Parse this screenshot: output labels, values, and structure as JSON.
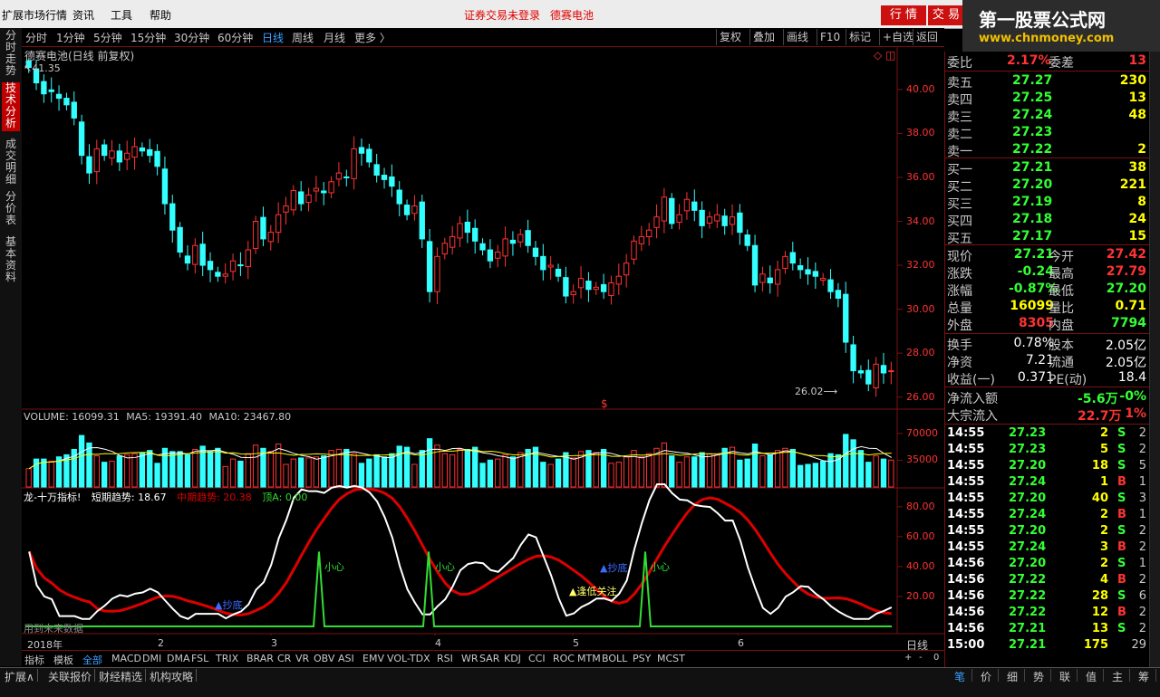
{
  "menu": {
    "items": [
      "扩展市场行情",
      "资讯",
      "工具",
      "帮助"
    ],
    "login_status": "证券交易未登录",
    "stock_name": "德赛电池",
    "btn_quote": "行 情",
    "btn_trade": "交 易"
  },
  "logo": {
    "line1": "第一股票公式网",
    "line2": "www.chnmoney.com"
  },
  "side_tabs": [
    "分时走势",
    "技术分析",
    "成交明细",
    "分价表",
    "基本资料"
  ],
  "periods": [
    "分时",
    "1分钟",
    "5分钟",
    "15分钟",
    "30分钟",
    "60分钟",
    "日线",
    "周线",
    "月线",
    "更多 〉"
  ],
  "active_period": "日线",
  "toolbar": [
    "复权",
    "叠加",
    "画线",
    "F10",
    "标记",
    "+自选",
    "返回"
  ],
  "main_chart": {
    "title": "德赛电池(日线 前复权)",
    "high_label": "41.35",
    "low_label": "26.02",
    "price_ticks": [
      "40.00",
      "38.00",
      "36.00",
      "34.00",
      "32.00",
      "30.00",
      "28.00",
      "26.00"
    ],
    "marker": "$"
  },
  "volume": {
    "legend_volume": "VOLUME: 16099.31",
    "legend_ma5": "MA5: 19391.40",
    "legend_ma10": "MA10: 23467.80",
    "ticks": [
      "70000",
      "35000"
    ]
  },
  "indicator": {
    "name": "龙-十万指标!",
    "short_trend": "短期趋势: 18.67",
    "mid_trend": "中期趋势: 20.38",
    "top_a": "顶A: 0.00",
    "ticks": [
      "80.00",
      "60.00",
      "40.00",
      "20.00"
    ],
    "future_note": "用到未来数据",
    "sig_careful": "小心",
    "sig_bottom": "抄底",
    "sig_watch": "逢低关注"
  },
  "x_axis": {
    "year": "2018年",
    "months": [
      "2",
      "3",
      "4",
      "5",
      "6"
    ],
    "period_label": "日线"
  },
  "indicator_tabs": [
    "指标",
    "模板",
    "全部",
    "MACD",
    "DMI",
    "DMA",
    "FSL",
    "TRIX",
    "BRAR",
    "CR",
    "VR",
    "OBV",
    "ASI",
    "EMV",
    "VOL-TDX",
    "RSI",
    "WR",
    "SAR",
    "KDJ",
    "CCI",
    "ROC",
    "MTM",
    "BOLL",
    "PSY",
    "MCST"
  ],
  "zoom_controls": [
    "+",
    "-",
    "0"
  ],
  "bottom_tabs": [
    "扩展∧",
    "关联报价",
    "财经精选",
    "机构攻略"
  ],
  "quote": {
    "weibi_label": "委比",
    "weibi": "2.17%",
    "weicha_label": "委差",
    "weicha": "13",
    "asks": [
      {
        "label": "卖五",
        "price": "27.27",
        "vol": "230"
      },
      {
        "label": "卖四",
        "price": "27.25",
        "vol": "13"
      },
      {
        "label": "卖三",
        "price": "27.24",
        "vol": "48"
      },
      {
        "label": "卖二",
        "price": "27.23",
        "vol": ""
      },
      {
        "label": "卖一",
        "price": "27.22",
        "vol": "2"
      }
    ],
    "bids": [
      {
        "label": "买一",
        "price": "27.21",
        "vol": "38"
      },
      {
        "label": "买二",
        "price": "27.20",
        "vol": "221"
      },
      {
        "label": "买三",
        "price": "27.19",
        "vol": "8"
      },
      {
        "label": "买四",
        "price": "27.18",
        "vol": "24"
      },
      {
        "label": "买五",
        "price": "27.17",
        "vol": "15"
      }
    ],
    "stats": [
      {
        "l1": "现价",
        "v1": "27.21",
        "c1": "#33ff33",
        "l2": "今开",
        "v2": "27.42",
        "c2": "#ff3333"
      },
      {
        "l1": "涨跌",
        "v1": "-0.24",
        "c1": "#33ff33",
        "l2": "最高",
        "v2": "27.79",
        "c2": "#ff3333"
      },
      {
        "l1": "涨幅",
        "v1": "-0.87%",
        "c1": "#33ff33",
        "l2": "最低",
        "v2": "27.20",
        "c2": "#33ff33"
      },
      {
        "l1": "总量",
        "v1": "16099",
        "c1": "#ffff00",
        "l2": "量比",
        "v2": "0.71",
        "c2": "#ffff00"
      },
      {
        "l1": "外盘",
        "v1": "8305",
        "c1": "#ff3333",
        "l2": "内盘",
        "v2": "7794",
        "c2": "#33ff33"
      }
    ],
    "info": [
      {
        "l1": "换手",
        "v1": "0.78%",
        "l2": "股本",
        "v2": "2.05亿"
      },
      {
        "l1": "净资",
        "v1": "7.21",
        "l2": "流通",
        "v2": "2.05亿"
      },
      {
        "l1": "收益(一)",
        "v1": "0.371",
        "l2": "PE(动)",
        "v2": "18.4"
      }
    ],
    "netflow_label": "净流入额",
    "netflow": "-5.6万",
    "netflow_pct": "-0%",
    "block_label": "大宗流入",
    "block": "22.7万",
    "block_pct": "1%"
  },
  "ticks": [
    {
      "time": "14:55",
      "price": "27.23",
      "vol": "2",
      "bs": "S",
      "n": "2"
    },
    {
      "time": "14:55",
      "price": "27.23",
      "vol": "5",
      "bs": "S",
      "n": "2"
    },
    {
      "time": "14:55",
      "price": "27.20",
      "vol": "18",
      "bs": "S",
      "n": "5"
    },
    {
      "time": "14:55",
      "price": "27.24",
      "vol": "1",
      "bs": "B",
      "n": "1"
    },
    {
      "time": "14:55",
      "price": "27.20",
      "vol": "40",
      "bs": "S",
      "n": "3"
    },
    {
      "time": "14:55",
      "price": "27.24",
      "vol": "2",
      "bs": "B",
      "n": "1"
    },
    {
      "time": "14:55",
      "price": "27.20",
      "vol": "2",
      "bs": "S",
      "n": "2"
    },
    {
      "time": "14:55",
      "price": "27.24",
      "vol": "3",
      "bs": "B",
      "n": "2"
    },
    {
      "time": "14:56",
      "price": "27.20",
      "vol": "2",
      "bs": "S",
      "n": "1"
    },
    {
      "time": "14:56",
      "price": "27.22",
      "vol": "4",
      "bs": "B",
      "n": "2"
    },
    {
      "time": "14:56",
      "price": "27.22",
      "vol": "28",
      "bs": "S",
      "n": "6"
    },
    {
      "time": "14:56",
      "price": "27.22",
      "vol": "12",
      "bs": "B",
      "n": "2"
    },
    {
      "time": "14:56",
      "price": "27.21",
      "vol": "13",
      "bs": "S",
      "n": "2"
    },
    {
      "time": "15:00",
      "price": "27.21",
      "vol": "175",
      "bs": "",
      "n": "29"
    }
  ],
  "right_tabs": [
    "笔",
    "价",
    "细",
    "势",
    "联",
    "值",
    "主",
    "筹"
  ],
  "active_right_tab": "笔",
  "colors": {
    "up": "#ff3333",
    "down": "#33ffff",
    "short_line": "#ffffff",
    "mid_line": "#dd0000",
    "signal_line": "#33dd33",
    "grid": "#7a1010"
  },
  "chart_data": {
    "type": "candlestick",
    "closes": [
      41.0,
      40.3,
      39.8,
      39.9,
      39.6,
      39.3,
      38.7,
      37.0,
      36.2,
      37.3,
      37.0,
      37.2,
      36.7,
      37.1,
      37.4,
      37.2,
      37.0,
      36.5,
      34.8,
      33.6,
      32.6,
      32.1,
      32.9,
      32.0,
      31.8,
      31.5,
      31.6,
      32.2,
      32.0,
      32.7,
      34.0,
      33.2,
      33.5,
      34.3,
      34.7,
      35.4,
      34.8,
      35.2,
      35.5,
      35.3,
      35.8,
      36.2,
      36.0,
      37.3,
      37.1,
      36.7,
      36.1,
      35.9,
      35.6,
      34.8,
      34.3,
      34.7,
      33.2,
      30.8,
      32.4,
      33.0,
      33.3,
      33.9,
      33.5,
      33.1,
      32.7,
      32.2,
      32.6,
      33.2,
      33.0,
      33.4,
      32.9,
      32.4,
      31.8,
      32.0,
      31.5,
      30.6,
      30.8,
      31.4,
      30.9,
      31.0,
      30.8,
      31.2,
      31.5,
      32.1,
      33.1,
      33.3,
      33.6,
      34.2,
      35.1,
      33.9,
      34.3,
      35.0,
      34.5,
      33.8,
      34.2,
      34.3,
      33.8,
      34.2,
      33.5,
      32.9,
      31.1,
      31.6,
      31.2,
      31.8,
      32.4,
      32.1,
      31.8,
      31.6,
      31.5,
      31.4,
      30.8,
      30.5,
      28.5,
      27.2,
      27.1,
      26.6,
      27.5,
      27.1,
      27.2
    ],
    "high": 41.35,
    "low": 26.02,
    "ylim": [
      25.7,
      41.6
    ],
    "volume_ylim": [
      0,
      90000
    ],
    "indicator_ylim": [
      0,
      92
    ]
  }
}
